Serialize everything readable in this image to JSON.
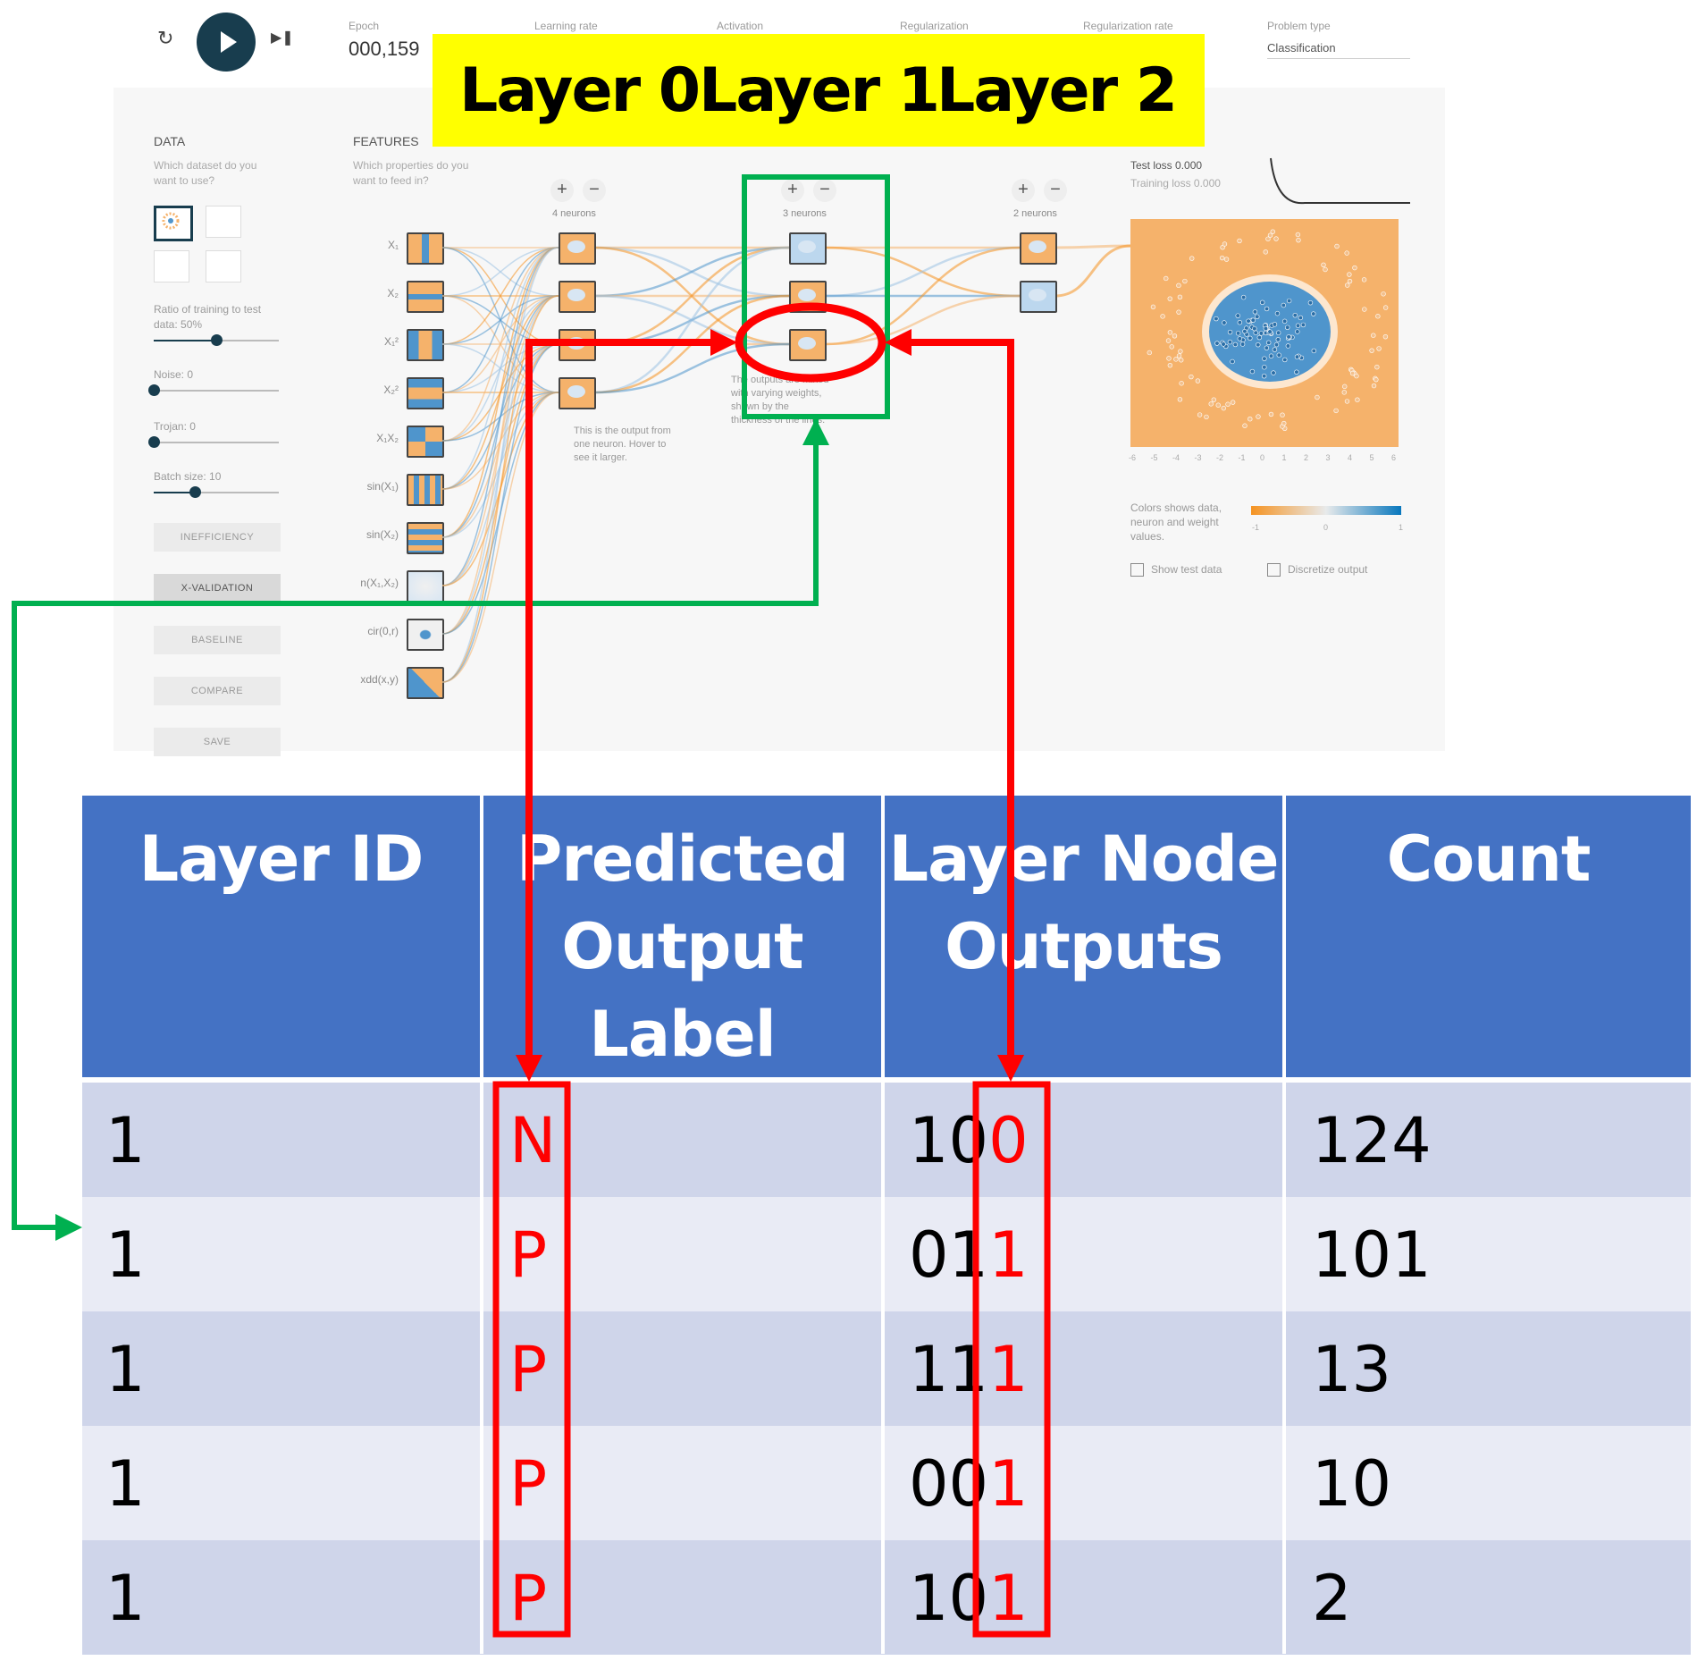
{
  "topbar": {
    "epoch_label": "Epoch",
    "epoch_value": "000,159",
    "learning_rate_label": "Learning rate",
    "activation_label": "Activation",
    "regularization_label": "Regularization",
    "regularization_rate_label": "Regularization rate",
    "problem_type_label": "Problem type",
    "problem_type_value": "Classification"
  },
  "layer_banner": [
    "Layer 0",
    "Layer 1",
    "Layer 2"
  ],
  "data_panel": {
    "title": "DATA",
    "subtitle": "Which dataset do you want to use?",
    "ratio_label": "Ratio of training to test data:  50%",
    "ratio_fraction": 0.5,
    "noise_label": "Noise:  0",
    "noise_fraction": 0.0,
    "trojan_label": "Trojan:  0",
    "trojan_fraction": 0.0,
    "batch_label": "Batch size:  10",
    "batch_fraction": 0.33,
    "buttons": [
      "INEFFICIENCY",
      "X-VALIDATION",
      "BASELINE",
      "COMPARE",
      "SAVE"
    ]
  },
  "features_panel": {
    "title": "FEATURES",
    "subtitle": "Which properties do you want to feed in?",
    "features": [
      "X₁",
      "X₂",
      "X₁²",
      "X₂²",
      "X₁X₂",
      "sin(X₁)",
      "sin(X₂)",
      "n(X₁,X₂)",
      "cir(0,r)",
      "xdd(x,y)"
    ]
  },
  "hidden_layers": [
    {
      "neurons_label": "4 neurons",
      "note": "This is the output from one neuron. Hover to see it larger."
    },
    {
      "neurons_label": "3 neurons",
      "note": "The outputs are mixed with varying weights, shown by the thickness of the lines."
    },
    {
      "neurons_label": "2 neurons",
      "note": ""
    }
  ],
  "output_panel": {
    "test_loss": "Test loss 0.000",
    "training_loss": "Training loss 0.000",
    "x_ticks": [
      "-6",
      "-5",
      "-4",
      "-3",
      "-2",
      "-1",
      "0",
      "1",
      "2",
      "3",
      "4",
      "5",
      "6"
    ],
    "legend_text": "Colors shows data, neuron and weight values.",
    "legend_ticks": [
      "-1",
      "0",
      "1"
    ],
    "show_test_data": "Show test data",
    "discretize_output": "Discretize output"
  },
  "table": {
    "headers": {
      "layer_id": "Layer ID",
      "predicted_label": "Predicted Output Label",
      "node_outputs": "Layer Node Outputs",
      "count": "Count"
    },
    "rows": [
      {
        "layer_id": "1",
        "label": "N",
        "outputs_prefix": "10",
        "outputs_last": "0",
        "count": "124"
      },
      {
        "layer_id": "1",
        "label": "P",
        "outputs_prefix": "01",
        "outputs_last": "1",
        "count": "101"
      },
      {
        "layer_id": "1",
        "label": "P",
        "outputs_prefix": "11",
        "outputs_last": "1",
        "count": "13"
      },
      {
        "layer_id": "1",
        "label": "P",
        "outputs_prefix": "00",
        "outputs_last": "1",
        "count": "10"
      },
      {
        "layer_id": "1",
        "label": "P",
        "outputs_prefix": "10",
        "outputs_last": "1",
        "count": "2"
      }
    ]
  },
  "colors": {
    "table_header": "#4472c4",
    "row_dark": "#cfd5ea",
    "row_light": "#e9ebf5",
    "annotation_red": "#ff0000",
    "annotation_green": "#00b050",
    "banner_yellow": "#ffff00",
    "neuron_orange": "#f5b26b",
    "neuron_blue": "#4f95cc"
  }
}
